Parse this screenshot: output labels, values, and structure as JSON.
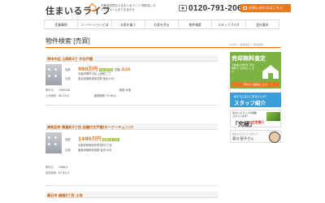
{
  "header": {
    "logo": "住まいるライフ",
    "tagline": "不動産売買なら住まいるライフ 物件探しからリフォームまでおまかせ",
    "phone": "0120-791-206",
    "contact_label": "お問い合わせはこちら"
  },
  "nav": [
    "売買事例",
    "リノベーションとは",
    "お家を買う",
    "お家を売る",
    "物件検索",
    "スタッフブログ",
    "会社案内"
  ],
  "page": {
    "title": "物件検索 [売買]",
    "breadcrumb": "HOME > 物件検索 > 物件検索"
  },
  "labels": {
    "price": "価格",
    "layout": "間取",
    "traffic": "交通",
    "land_area": "土地面積",
    "building_area": "建物面積",
    "built": "築年月",
    "structure": "構造"
  },
  "listings": [
    {
      "title": "堺市中区 土師町2丁 中古戸建",
      "price": "980万円",
      "tags": [
        "中古",
        "戸建"
      ],
      "layout": "3LDK",
      "address": "大阪府堺市中区 土師町二丁",
      "traffic": "泉北高速鉄道深井駅 徒歩15分",
      "land_area": "80.29㎡",
      "building_area": "72.98㎡",
      "built": "1965/08",
      "structure": "木造"
    },
    {
      "title": "岸和田市 箕島町2丁目 店舗付き戸建(オーナーチェンジ)",
      "price": "1480万円",
      "tags": [
        "店舗付",
        "戸建"
      ],
      "layout": "",
      "address": "大阪府岸和田市箕島町2丁目",
      "traffic": "南海本線岸和田駅 徒歩10分",
      "land_area": "",
      "building_area": "67.63㎡",
      "built": "1986/1",
      "structure": ""
    },
    {
      "title": "高石市 綾園2丁目 土地",
      "price": "",
      "tags": [],
      "layout": "",
      "address": "",
      "traffic": "",
      "land_area": "",
      "building_area": "",
      "built": "",
      "structure": ""
    }
  ],
  "sidebar": {
    "sell_title": "売却無料査定",
    "sell_sub": "不動産の売却を 完全無料で お手伝いします",
    "sell_btn": "売却のご相談はこちら",
    "staff_small": "私たちに会いに来ませんか？",
    "staff_title": "スタッフ紹介",
    "mag_top": "住まいるライフが掲載されています！",
    "mag_big": "「究極」",
    "mag_sub": "の住宅選び",
    "card_small": "住まいるライフ スタッフ",
    "card_name": "菊口 智子さん"
  },
  "colors": {
    "accent": "#e8791e",
    "green": "#7cb342",
    "blue": "#3c9ed8"
  }
}
